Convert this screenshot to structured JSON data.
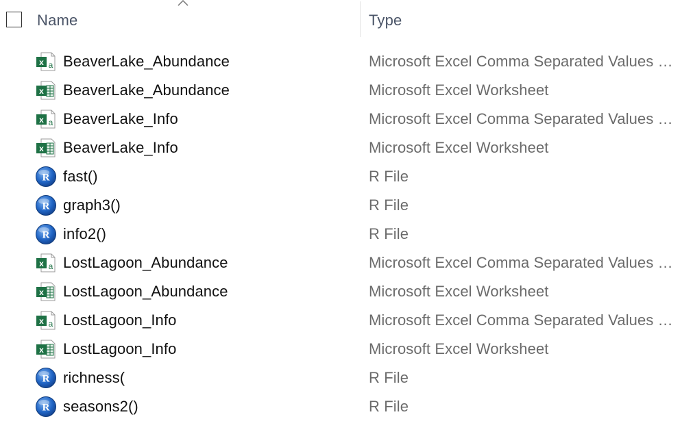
{
  "header": {
    "name_label": "Name",
    "type_label": "Type"
  },
  "files": [
    {
      "name": "BeaverLake_Abundance",
      "type": "Microsoft Excel Comma Separated Values File",
      "icon": "excel-csv-icon"
    },
    {
      "name": "BeaverLake_Abundance",
      "type": "Microsoft Excel Worksheet",
      "icon": "excel-worksheet-icon"
    },
    {
      "name": "BeaverLake_Info",
      "type": "Microsoft Excel Comma Separated Values File",
      "icon": "excel-csv-icon"
    },
    {
      "name": "BeaverLake_Info",
      "type": "Microsoft Excel Worksheet",
      "icon": "excel-worksheet-icon"
    },
    {
      "name": "fast()",
      "type": "R File",
      "icon": "r-file-icon"
    },
    {
      "name": "graph3()",
      "type": "R File",
      "icon": "r-file-icon"
    },
    {
      "name": "info2()",
      "type": "R File",
      "icon": "r-file-icon"
    },
    {
      "name": "LostLagoon_Abundance",
      "type": "Microsoft Excel Comma Separated Values File",
      "icon": "excel-csv-icon"
    },
    {
      "name": "LostLagoon_Abundance",
      "type": "Microsoft Excel Worksheet",
      "icon": "excel-worksheet-icon"
    },
    {
      "name": "LostLagoon_Info",
      "type": "Microsoft Excel Comma Separated Values File",
      "icon": "excel-csv-icon"
    },
    {
      "name": "LostLagoon_Info",
      "type": "Microsoft Excel Worksheet",
      "icon": "excel-worksheet-icon"
    },
    {
      "name": "richness(",
      "type": "R File",
      "icon": "r-file-icon"
    },
    {
      "name": "seasons2()",
      "type": "R File",
      "icon": "r-file-icon"
    }
  ],
  "colors": {
    "excel_green": "#1e7145",
    "r_blue": "#2166c6",
    "header_text": "#4a5467",
    "type_text": "#6b6b6b"
  }
}
